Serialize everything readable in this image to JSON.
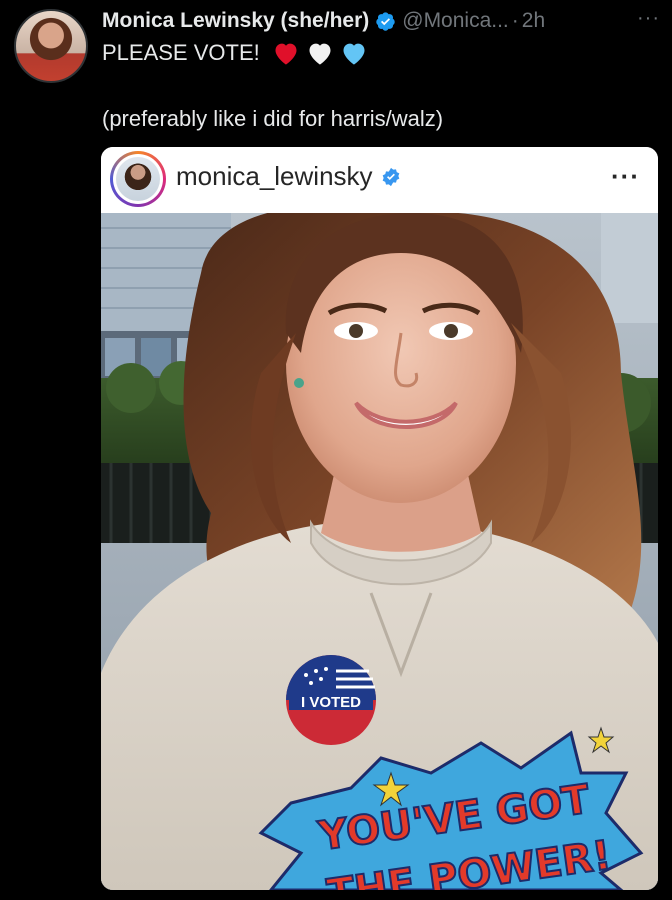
{
  "tweet": {
    "author_name": "Monica Lewinsky (she/her)",
    "handle": "@Monica...",
    "separator": "·",
    "time": "2h",
    "more_label": "···",
    "text_line1": "PLEASE VOTE!",
    "text_line2": "(preferably like i did for harris/walz)",
    "hearts": [
      "red-heart-icon",
      "white-heart-icon",
      "blue-heart-icon"
    ]
  },
  "embedded_post": {
    "username": "monica_lewinsky",
    "more_label": "···",
    "image": {
      "sticker_text": "I VOTED",
      "shirt_text_line1": "YOU'VE GOT",
      "shirt_text_line2": "THE POWER!"
    }
  },
  "colors": {
    "background": "#000000",
    "text_primary": "#e7e9ea",
    "text_secondary": "#71767b",
    "verified_blue": "#1d9bf0",
    "card_header_bg": "#ffffff",
    "ig_text": "#262626"
  }
}
